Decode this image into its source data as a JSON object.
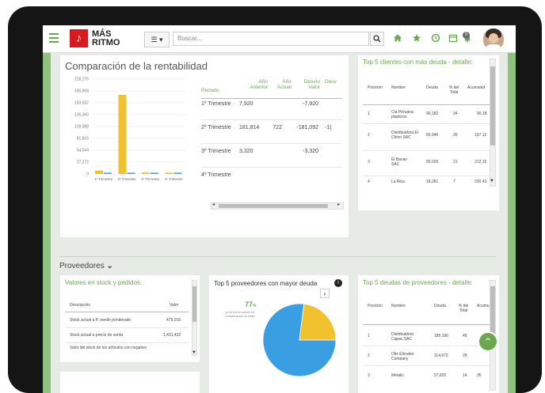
{
  "header": {
    "logo_line1": "MÁS",
    "logo_line2": "RITMO",
    "logo_glyph": "♪",
    "search_placeholder": "Buscar...",
    "notification_count": "5",
    "view_toggle_label": "☰ ▾"
  },
  "rentabilidad": {
    "title": "Comparación de la rentabilidad",
    "headers": [
      "Periodo",
      "Año Anterior",
      "Año Actual",
      "Desvío Valor",
      "Desv"
    ],
    "rows": [
      {
        "periodo": "1º Trimestre",
        "anterior": "7,920",
        "actual": "",
        "desvio": "-7,920",
        "desv": ""
      },
      {
        "periodo": "2º Trimestre",
        "anterior": "181,814",
        "actual": "722",
        "desvio": "-181,092",
        "desv": "-1("
      },
      {
        "periodo": "3º Trimestre",
        "anterior": "3,320",
        "actual": "",
        "desvio": "-3,320",
        "desv": ""
      },
      {
        "periodo": "4º Trimestre",
        "anterior": "",
        "actual": "",
        "desvio": "",
        "desv": ""
      }
    ]
  },
  "chart_data": {
    "type": "bar",
    "categories": [
      "1º Trimestre",
      "2º Trimestre",
      "3º Trimestre",
      "4º Trimestre"
    ],
    "series": [
      {
        "values": [
          7920,
          181814,
          3320,
          0
        ],
        "color": "#f2c12e"
      },
      {
        "values": [
          0,
          722,
          0,
          0
        ],
        "color": "#41a8d8"
      }
    ],
    "yticks": [
      "218,176",
      "190,904",
      "163,632",
      "136,360",
      "109,088",
      "81,816",
      "54,544",
      "27,272",
      "0"
    ],
    "ylim": [
      0,
      218176
    ]
  },
  "clientes_deuda": {
    "title": "Top 5 clientes con más deuda - detalle:",
    "headers": [
      "Posición",
      "Nombre",
      "Deuda",
      "% del Total",
      "Acumulad"
    ],
    "rows": [
      {
        "pos": "1",
        "nombre": "Cia Peruana plasticos",
        "deuda": "90,182",
        "pct": "34",
        "acum": "90,18"
      },
      {
        "pos": "2",
        "nombre": "Distribuidora El Chino SAC",
        "deuda": "66,946",
        "pct": "26",
        "acum": "157,12"
      },
      {
        "pos": "3",
        "nombre": "El Bacan SAC",
        "deuda": "55,026",
        "pct": "21",
        "acum": "212,15"
      },
      {
        "pos": "4",
        "nombre": "La Rica",
        "deuda": "18,281",
        "pct": "7",
        "acum": "230,43"
      }
    ]
  },
  "proveedores_section": {
    "title": "Proveedores",
    "chevron": "⌄"
  },
  "stock": {
    "title": "Valores en stock y pedidos:",
    "headers": [
      "Descripción",
      "Valor"
    ],
    "rows": [
      {
        "desc": "Stock actual a P. medio ponderado",
        "valor": "479,016"
      },
      {
        "desc": "Stock actual a precio de venta",
        "valor": "1,431,432"
      },
      {
        "desc": "Valor del stock de los artículos con negativo",
        "valor": ""
      }
    ]
  },
  "top_proveedores": {
    "title": "Top 5 proveedores con mayor deuda",
    "percent": "77",
    "percent_sign": "%",
    "note": "(a la fecha actual en comparación al total)",
    "slices": [
      {
        "value": 77,
        "color": "#3a9ee2"
      },
      {
        "value": 23,
        "color": "#f2c12e"
      }
    ]
  },
  "deudas_proveedores": {
    "title": "Top 5 deudas de proveedores - detalle:",
    "headers": [
      "Posición",
      "Nombre",
      "Deuda",
      "% del Total",
      "Acumu"
    ],
    "rows": [
      {
        "pos": "1",
        "nombre": "Distribuidora Capac SAC",
        "deuda": "185,196",
        "pct": "45",
        "acum": ""
      },
      {
        "pos": "2",
        "nombre": "Otis Elevator Company",
        "deuda": "114,672",
        "pct": "28",
        "acum": ""
      },
      {
        "pos": "3",
        "nombre": "Metalic",
        "deuda": "57,820",
        "pct": "14",
        "acum": "35"
      }
    ]
  }
}
